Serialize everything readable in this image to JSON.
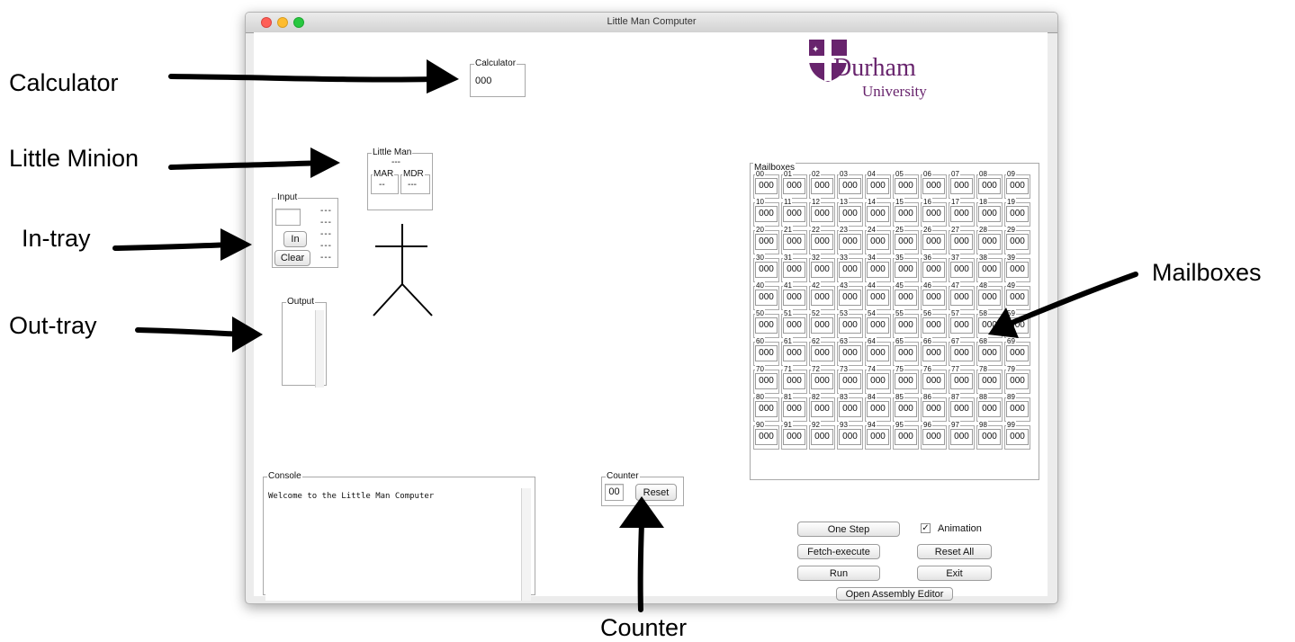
{
  "annotations": {
    "calculator": "Calculator",
    "little_minion": "Little Minion",
    "in_tray": "In-tray",
    "out_tray": "Out-tray",
    "mailboxes": "Mailboxes",
    "counter": "Counter"
  },
  "window": {
    "title": "Little Man Computer"
  },
  "logo": {
    "name": "Durham",
    "sub": "University",
    "color": "#68246d"
  },
  "calculator": {
    "label": "Calculator",
    "value": "000"
  },
  "little_man": {
    "label": "Little Man",
    "value": "---",
    "mar_label": "MAR",
    "mar_value": "--",
    "mdr_label": "MDR",
    "mdr_value": "---"
  },
  "input": {
    "label": "Input",
    "in_button": "In",
    "clear_button": "Clear",
    "field_value": "",
    "queue": [
      "---",
      "---",
      "---",
      "---",
      "---"
    ]
  },
  "output": {
    "label": "Output"
  },
  "mailboxes": {
    "label": "Mailboxes",
    "cells": [
      {
        "n": "00",
        "v": "000"
      },
      {
        "n": "01",
        "v": "000"
      },
      {
        "n": "02",
        "v": "000"
      },
      {
        "n": "03",
        "v": "000"
      },
      {
        "n": "04",
        "v": "000"
      },
      {
        "n": "05",
        "v": "000"
      },
      {
        "n": "06",
        "v": "000"
      },
      {
        "n": "07",
        "v": "000"
      },
      {
        "n": "08",
        "v": "000"
      },
      {
        "n": "09",
        "v": "000"
      },
      {
        "n": "10",
        "v": "000"
      },
      {
        "n": "11",
        "v": "000"
      },
      {
        "n": "12",
        "v": "000"
      },
      {
        "n": "13",
        "v": "000"
      },
      {
        "n": "14",
        "v": "000"
      },
      {
        "n": "15",
        "v": "000"
      },
      {
        "n": "16",
        "v": "000"
      },
      {
        "n": "17",
        "v": "000"
      },
      {
        "n": "18",
        "v": "000"
      },
      {
        "n": "19",
        "v": "000"
      },
      {
        "n": "20",
        "v": "000"
      },
      {
        "n": "21",
        "v": "000"
      },
      {
        "n": "22",
        "v": "000"
      },
      {
        "n": "23",
        "v": "000"
      },
      {
        "n": "24",
        "v": "000"
      },
      {
        "n": "25",
        "v": "000"
      },
      {
        "n": "26",
        "v": "000"
      },
      {
        "n": "27",
        "v": "000"
      },
      {
        "n": "28",
        "v": "000"
      },
      {
        "n": "29",
        "v": "000"
      },
      {
        "n": "30",
        "v": "000"
      },
      {
        "n": "31",
        "v": "000"
      },
      {
        "n": "32",
        "v": "000"
      },
      {
        "n": "33",
        "v": "000"
      },
      {
        "n": "34",
        "v": "000"
      },
      {
        "n": "35",
        "v": "000"
      },
      {
        "n": "36",
        "v": "000"
      },
      {
        "n": "37",
        "v": "000"
      },
      {
        "n": "38",
        "v": "000"
      },
      {
        "n": "39",
        "v": "000"
      },
      {
        "n": "40",
        "v": "000"
      },
      {
        "n": "41",
        "v": "000"
      },
      {
        "n": "42",
        "v": "000"
      },
      {
        "n": "43",
        "v": "000"
      },
      {
        "n": "44",
        "v": "000"
      },
      {
        "n": "45",
        "v": "000"
      },
      {
        "n": "46",
        "v": "000"
      },
      {
        "n": "47",
        "v": "000"
      },
      {
        "n": "48",
        "v": "000"
      },
      {
        "n": "49",
        "v": "000"
      },
      {
        "n": "50",
        "v": "000"
      },
      {
        "n": "51",
        "v": "000"
      },
      {
        "n": "52",
        "v": "000"
      },
      {
        "n": "53",
        "v": "000"
      },
      {
        "n": "54",
        "v": "000"
      },
      {
        "n": "55",
        "v": "000"
      },
      {
        "n": "56",
        "v": "000"
      },
      {
        "n": "57",
        "v": "000"
      },
      {
        "n": "58",
        "v": "000"
      },
      {
        "n": "59",
        "v": "000"
      },
      {
        "n": "60",
        "v": "000"
      },
      {
        "n": "61",
        "v": "000"
      },
      {
        "n": "62",
        "v": "000"
      },
      {
        "n": "63",
        "v": "000"
      },
      {
        "n": "64",
        "v": "000"
      },
      {
        "n": "65",
        "v": "000"
      },
      {
        "n": "66",
        "v": "000"
      },
      {
        "n": "67",
        "v": "000"
      },
      {
        "n": "68",
        "v": "000"
      },
      {
        "n": "69",
        "v": "000"
      },
      {
        "n": "70",
        "v": "000"
      },
      {
        "n": "71",
        "v": "000"
      },
      {
        "n": "72",
        "v": "000"
      },
      {
        "n": "73",
        "v": "000"
      },
      {
        "n": "74",
        "v": "000"
      },
      {
        "n": "75",
        "v": "000"
      },
      {
        "n": "76",
        "v": "000"
      },
      {
        "n": "77",
        "v": "000"
      },
      {
        "n": "78",
        "v": "000"
      },
      {
        "n": "79",
        "v": "000"
      },
      {
        "n": "80",
        "v": "000"
      },
      {
        "n": "81",
        "v": "000"
      },
      {
        "n": "82",
        "v": "000"
      },
      {
        "n": "83",
        "v": "000"
      },
      {
        "n": "84",
        "v": "000"
      },
      {
        "n": "85",
        "v": "000"
      },
      {
        "n": "86",
        "v": "000"
      },
      {
        "n": "87",
        "v": "000"
      },
      {
        "n": "88",
        "v": "000"
      },
      {
        "n": "89",
        "v": "000"
      },
      {
        "n": "90",
        "v": "000"
      },
      {
        "n": "91",
        "v": "000"
      },
      {
        "n": "92",
        "v": "000"
      },
      {
        "n": "93",
        "v": "000"
      },
      {
        "n": "94",
        "v": "000"
      },
      {
        "n": "95",
        "v": "000"
      },
      {
        "n": "96",
        "v": "000"
      },
      {
        "n": "97",
        "v": "000"
      },
      {
        "n": "98",
        "v": "000"
      },
      {
        "n": "99",
        "v": "000"
      }
    ]
  },
  "console": {
    "label": "Console",
    "text": "Welcome to the Little Man Computer"
  },
  "counter": {
    "label": "Counter",
    "value": "00",
    "reset_button": "Reset"
  },
  "controls": {
    "one_step": "One Step",
    "animation": "Animation",
    "animation_checked": true,
    "fetch_execute": "Fetch-execute",
    "reset_all": "Reset All",
    "run": "Run",
    "exit": "Exit",
    "open_editor": "Open Assembly Editor"
  }
}
